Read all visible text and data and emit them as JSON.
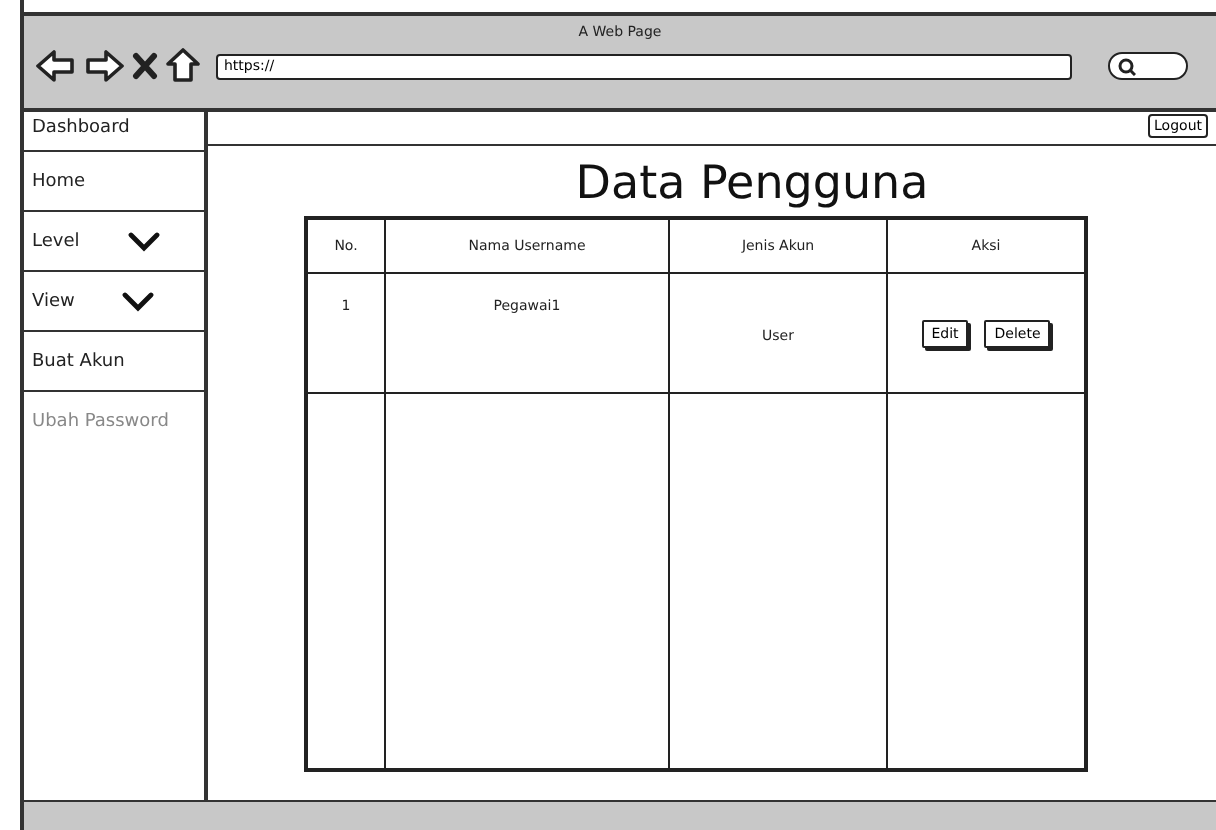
{
  "window": {
    "title": "A Web Page"
  },
  "address_bar": {
    "value": "https://"
  },
  "sidebar": {
    "items": [
      {
        "label": "Dashboard",
        "kind": "link",
        "disabled": false
      },
      {
        "label": "Home",
        "kind": "link",
        "disabled": false
      },
      {
        "label": "Level",
        "kind": "dropdown",
        "disabled": false
      },
      {
        "label": "View",
        "kind": "dropdown",
        "disabled": false
      },
      {
        "label": "Buat Akun",
        "kind": "link",
        "disabled": false
      },
      {
        "label": "Ubah Password",
        "kind": "link",
        "disabled": true
      }
    ]
  },
  "logout_button": "Logout",
  "heading": "Data Pengguna",
  "table": {
    "columns": [
      "No.",
      "Nama Username",
      "Jenis Akun",
      "Aksi"
    ],
    "rows": [
      {
        "no": "1",
        "username": "Pegawai1",
        "account_type": "User",
        "actions": [
          "Edit",
          "Delete"
        ]
      }
    ]
  }
}
